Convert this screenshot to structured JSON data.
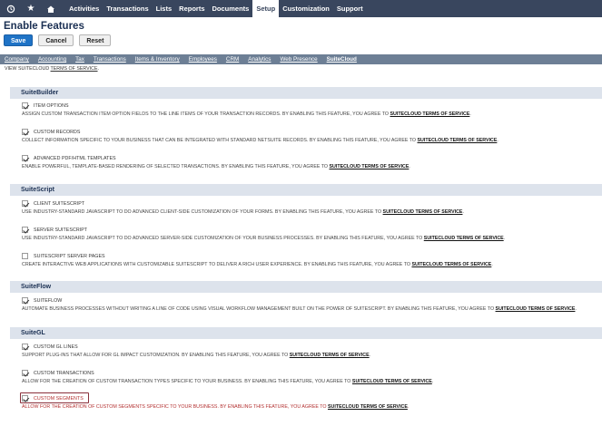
{
  "nav": {
    "items": [
      "Activities",
      "Transactions",
      "Lists",
      "Reports",
      "Documents",
      "Setup",
      "Customization",
      "Support"
    ],
    "active": "Setup"
  },
  "page": {
    "title": "Enable Features",
    "save_label": "Save",
    "cancel_label": "Cancel",
    "reset_label": "Reset"
  },
  "tabs": [
    "Company",
    "Accounting",
    "Tax",
    "Transactions",
    "Items & Inventory",
    "Employees",
    "CRM",
    "Analytics",
    "Web Presence",
    "SuiteCloud"
  ],
  "active_tab": "SuiteCloud",
  "subline": {
    "prefix": "VIEW SUITECLOUD ",
    "link": "TERMS OF SERVICE",
    "suffix": "."
  },
  "sections": [
    {
      "title": "SuiteBuilder",
      "features": [
        {
          "label": "ITEM OPTIONS",
          "checked": true,
          "desc": "ASSIGN CUSTOM TRANSACTION ITEM OPTION FIELDS TO THE LINE ITEMS OF YOUR TRANSACTION RECORDS. BY ENABLING THIS FEATURE, YOU AGREE TO ",
          "link": "SUITECLOUD TERMS OF SERVICE"
        },
        {
          "label": "CUSTOM RECORDS",
          "checked": true,
          "desc": "COLLECT INFORMATION SPECIFIC TO YOUR BUSINESS THAT CAN BE INTEGRATED WITH STANDARD NETSUITE RECORDS. BY ENABLING THIS FEATURE, YOU AGREE TO ",
          "link": "SUITECLOUD TERMS OF SERVICE"
        },
        {
          "label": "ADVANCED PDF/HTML TEMPLATES",
          "checked": true,
          "desc": "ENABLE POWERFUL, TEMPLATE-BASED RENDERING OF SELECTED TRANSACTIONS. BY ENABLING THIS FEATURE, YOU AGREE TO ",
          "link": "SUITECLOUD TERMS OF SERVICE"
        }
      ]
    },
    {
      "title": "SuiteScript",
      "features": [
        {
          "label": "CLIENT SUITESCRIPT",
          "checked": true,
          "desc": "USE INDUSTRY-STANDARD JAVASCRIPT TO DO ADVANCED CLIENT-SIDE CUSTOMIZATION OF YOUR FORMS. BY ENABLING THIS FEATURE, YOU AGREE TO ",
          "link": "SUITECLOUD TERMS OF SERVICE"
        },
        {
          "label": "SERVER SUITESCRIPT",
          "checked": true,
          "desc": "USE INDUSTRY-STANDARD JAVASCRIPT TO DO ADVANCED SERVER-SIDE CUSTOMIZATION OF YOUR BUSINESS PROCESSES. BY ENABLING THIS FEATURE, YOU AGREE TO ",
          "link": "SUITECLOUD TERMS OF SERVICE"
        },
        {
          "label": "SUITESCRIPT SERVER PAGES",
          "checked": false,
          "desc": "CREATE INTERACTIVE WEB APPLICATIONS WITH CUSTOMIZABLE SUITESCRIPT TO DELIVER A RICH USER EXPERIENCE. BY ENABLING THIS FEATURE, YOU AGREE TO ",
          "link": "SUITECLOUD TERMS OF SERVICE"
        }
      ]
    },
    {
      "title": "SuiteFlow",
      "features": [
        {
          "label": "SUITEFLOW",
          "checked": true,
          "desc": "AUTOMATE BUSINESS PROCESSES WITHOUT WRITING A LINE OF CODE USING VISUAL WORKFLOW MANAGEMENT BUILT ON THE POWER OF SUITESCRIPT. BY ENABLING THIS FEATURE, YOU AGREE TO ",
          "link": "SUITECLOUD TERMS OF SERVICE"
        }
      ]
    },
    {
      "title": "SuiteGL",
      "features": [
        {
          "label": "CUSTOM GL LINES",
          "checked": true,
          "desc": "SUPPORT PLUG-INS THAT ALLOW FOR GL IMPACT CUSTOMIZATION. BY ENABLING THIS FEATURE, YOU AGREE TO ",
          "link": "SUITECLOUD TERMS OF SERVICE"
        },
        {
          "label": "CUSTOM TRANSACTIONS",
          "checked": true,
          "desc": "ALLOW FOR THE CREATION OF CUSTOM TRANSACTION TYPES SPECIFIC TO YOUR BUSINESS. BY ENABLING THIS FEATURE, YOU AGREE TO ",
          "link": "SUITECLOUD TERMS OF SERVICE"
        },
        {
          "label": "CUSTOM SEGMENTS",
          "checked": true,
          "desc": "ALLOW FOR THE CREATION OF CUSTOM SEGMENTS SPECIFIC TO YOUR BUSINESS. BY ENABLING THIS FEATURE, YOU AGREE TO ",
          "link": "SUITECLOUD TERMS OF SERVICE"
        }
      ]
    }
  ],
  "colors": {
    "nav_bg": "#39465e",
    "tab_bg": "#6d7f95",
    "section_bg": "#dde3ec",
    "primary_button": "#1f73c6",
    "highlight": "#8a2f3a"
  }
}
